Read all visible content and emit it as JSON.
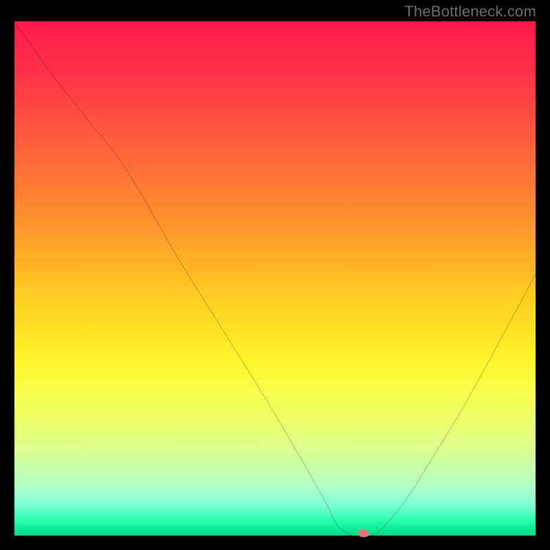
{
  "watermark": "TheBottleneck.com",
  "chart_data": {
    "type": "line",
    "title": "",
    "xlabel": "",
    "ylabel": "",
    "xlim": [
      0,
      100
    ],
    "ylim": [
      0,
      100
    ],
    "grid": false,
    "legend": false,
    "background": "red-to-green vertical heat gradient",
    "series": [
      {
        "name": "bottleneck-curve",
        "x": [
          0,
          7,
          14,
          21,
          28,
          32,
          40,
          48,
          55,
          60,
          62,
          65,
          67,
          70,
          75,
          80,
          86,
          92,
          100
        ],
        "y": [
          100,
          90,
          81,
          72,
          60,
          53,
          40,
          27,
          15,
          6,
          2,
          0,
          0,
          1,
          7,
          15,
          25,
          36,
          51
        ]
      }
    ],
    "marker": {
      "x": 67,
      "y": 0.5,
      "shape": "rounded-rect",
      "color": "#ff6e7a"
    }
  }
}
